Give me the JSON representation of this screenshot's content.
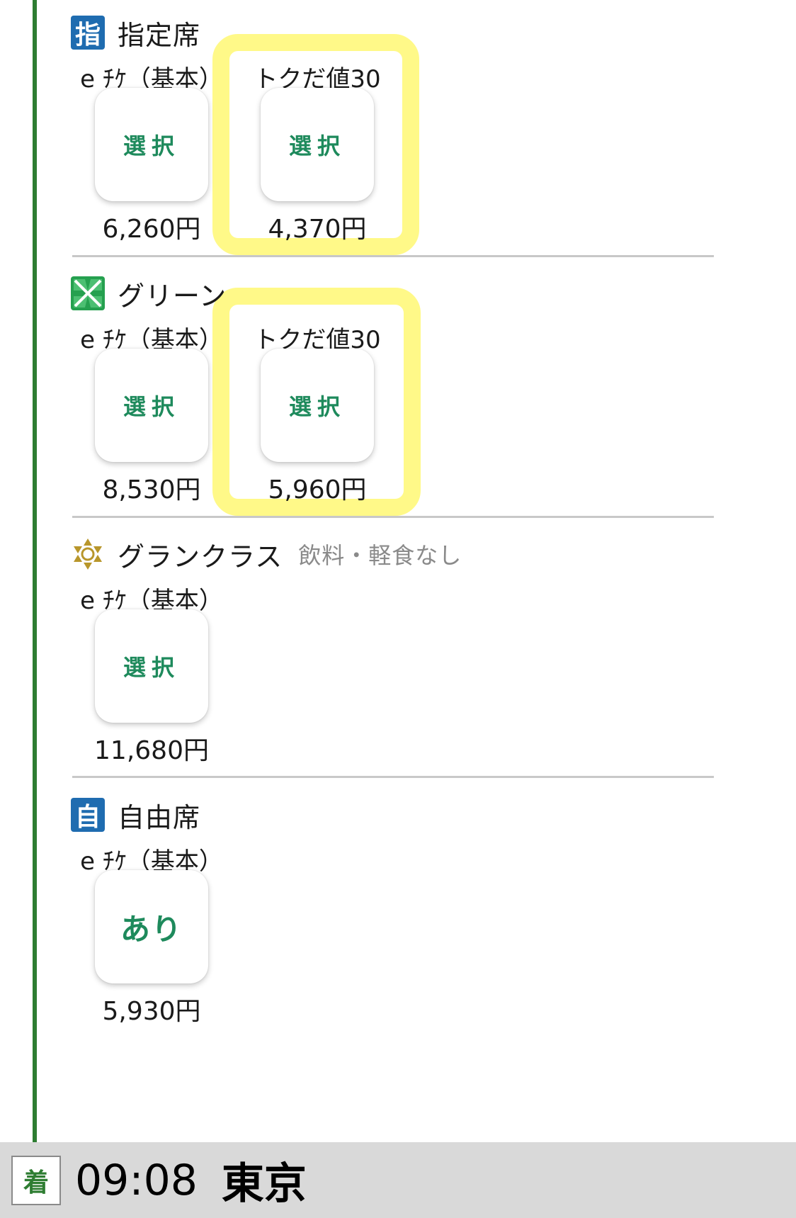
{
  "sections": [
    {
      "icon_char": "指",
      "icon_name": "reserved-seat-icon",
      "title": "指定席",
      "note": "",
      "fares": [
        {
          "label": "e ﾁｹ（基本）",
          "button": "選択",
          "price": "6,260円"
        },
        {
          "label": "トクだ値30",
          "button": "選択",
          "price": "4,370円"
        }
      ]
    },
    {
      "icon_name": "green-car-clover-icon",
      "title": "グリーン",
      "note": "",
      "fares": [
        {
          "label": "e ﾁｹ（基本）",
          "button": "選択",
          "price": "8,530円"
        },
        {
          "label": "トクだ値30",
          "button": "選択",
          "price": "5,960円"
        }
      ]
    },
    {
      "icon_name": "gran-class-emblem-icon",
      "title": "グランクラス",
      "note": "飲料・軽食なし",
      "fares": [
        {
          "label": "e ﾁｹ（基本）",
          "button": "選択",
          "price": "11,680円"
        }
      ]
    },
    {
      "icon_char": "自",
      "icon_name": "non-reserved-seat-icon",
      "title": "自由席",
      "note": "",
      "fares": [
        {
          "label": "e ﾁｹ（基本）",
          "button": "あり",
          "price": "5,930円"
        }
      ]
    }
  ],
  "arrival": {
    "badge": "着",
    "time": "09:08",
    "station": "東京"
  },
  "colors": {
    "route_line": "#2e7d32",
    "button_text": "#1e8a5c",
    "highlight": "#fff988",
    "class_icon_blue": "#1f6cb0",
    "green_clover": "#25a04f",
    "gran_class_gold": "#b8962b"
  }
}
